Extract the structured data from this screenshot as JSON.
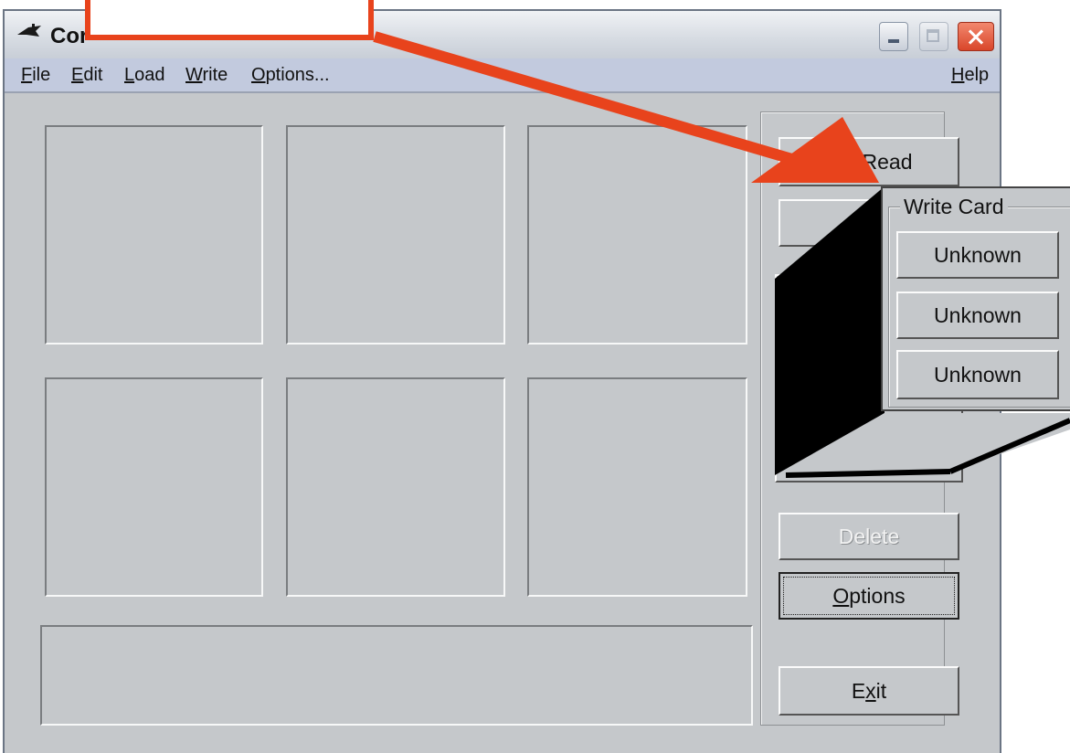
{
  "window": {
    "title": "Cor"
  },
  "menubar": {
    "items": [
      {
        "label": "File",
        "key": "F",
        "rest": "ile"
      },
      {
        "label": "Edit",
        "key": "E",
        "rest": "dit"
      },
      {
        "label": "Load",
        "key": "L",
        "rest": "oad"
      },
      {
        "label": "Write",
        "key": "W",
        "rest": "rite"
      },
      {
        "label": "Options...",
        "key": "O",
        "rest": "ptions..."
      }
    ],
    "help": {
      "label": "Help",
      "key": "H",
      "rest": "elp"
    }
  },
  "sidebar": {
    "read": "Read",
    "delete": "Delete",
    "options": {
      "key": "O",
      "rest": "ptions"
    },
    "exit": {
      "before": "E",
      "key": "x",
      "rest": "it"
    }
  },
  "write_card_popup": {
    "title": "Write Card",
    "buttons": [
      "Unknown",
      "Unknown",
      "Unknown"
    ]
  },
  "colors": {
    "window_face": "#c5c8cb",
    "menubar": "#c2cade",
    "callout_red": "#e8431c"
  },
  "icons": [
    "app-icon",
    "minimize-icon",
    "maximize-icon",
    "close-icon",
    "callout-arrow-icon"
  ]
}
